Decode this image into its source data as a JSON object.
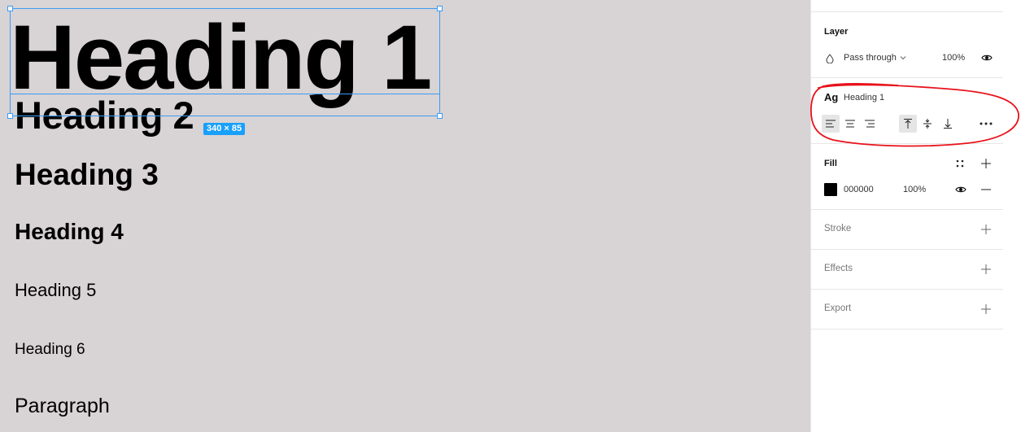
{
  "canvas": {
    "background": "#d8d3d4",
    "texts": {
      "h1": "Heading 1",
      "h2": "Heading 2",
      "h3": "Heading 3",
      "h4": "Heading 4",
      "h5": "Heading 5",
      "h6": "Heading 6",
      "paragraph": "Paragraph"
    },
    "selection": {
      "size_label": "340 × 85",
      "color": "#3b9df5"
    }
  },
  "panel": {
    "layer": {
      "title": "Layer",
      "blend_mode": "Pass through",
      "opacity": "100%",
      "blend_icon": "droplet-icon",
      "visibility_icon": "eye-icon"
    },
    "text": {
      "ag_label": "Ag",
      "style_name": "Heading 1",
      "align_icons": [
        "align-left-icon",
        "align-center-icon",
        "align-right-icon"
      ],
      "valign_icons": [
        "align-top-icon",
        "align-middle-icon",
        "align-bottom-icon"
      ],
      "more_icon": "more-icon"
    },
    "fill": {
      "title": "Fill",
      "hex": "000000",
      "opacity": "100%",
      "color": "#000000"
    },
    "stroke": {
      "title": "Stroke"
    },
    "effects": {
      "title": "Effects"
    },
    "export": {
      "title": "Export"
    }
  },
  "annotation": {
    "color": "#e8121b"
  }
}
